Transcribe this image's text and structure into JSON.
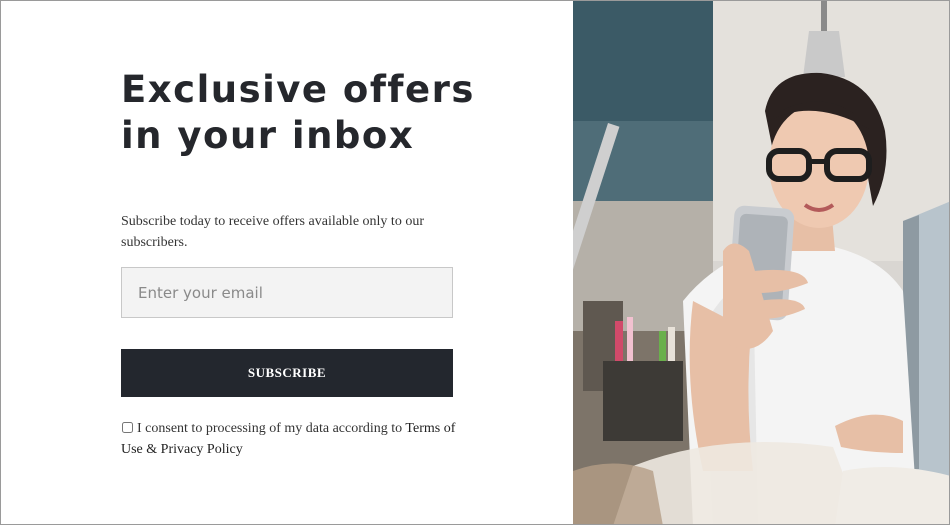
{
  "headline": {
    "line1": "Exclusive offers",
    "line2": "in your inbox"
  },
  "description": "Subscribe today to receive offers available only to our subscribers.",
  "form": {
    "email_placeholder": "Enter your email",
    "email_value": "",
    "subscribe_label": "SUBSCRIBE",
    "consent_text": "I consent to processing of my data according to ",
    "consent_link": "Terms of Use & Privacy Policy",
    "consent_checked": false
  },
  "colors": {
    "button_bg": "#23272e",
    "heading": "#25272c",
    "input_bg": "#f3f3f3"
  },
  "image": {
    "subject": "woman-with-phone-photo"
  }
}
